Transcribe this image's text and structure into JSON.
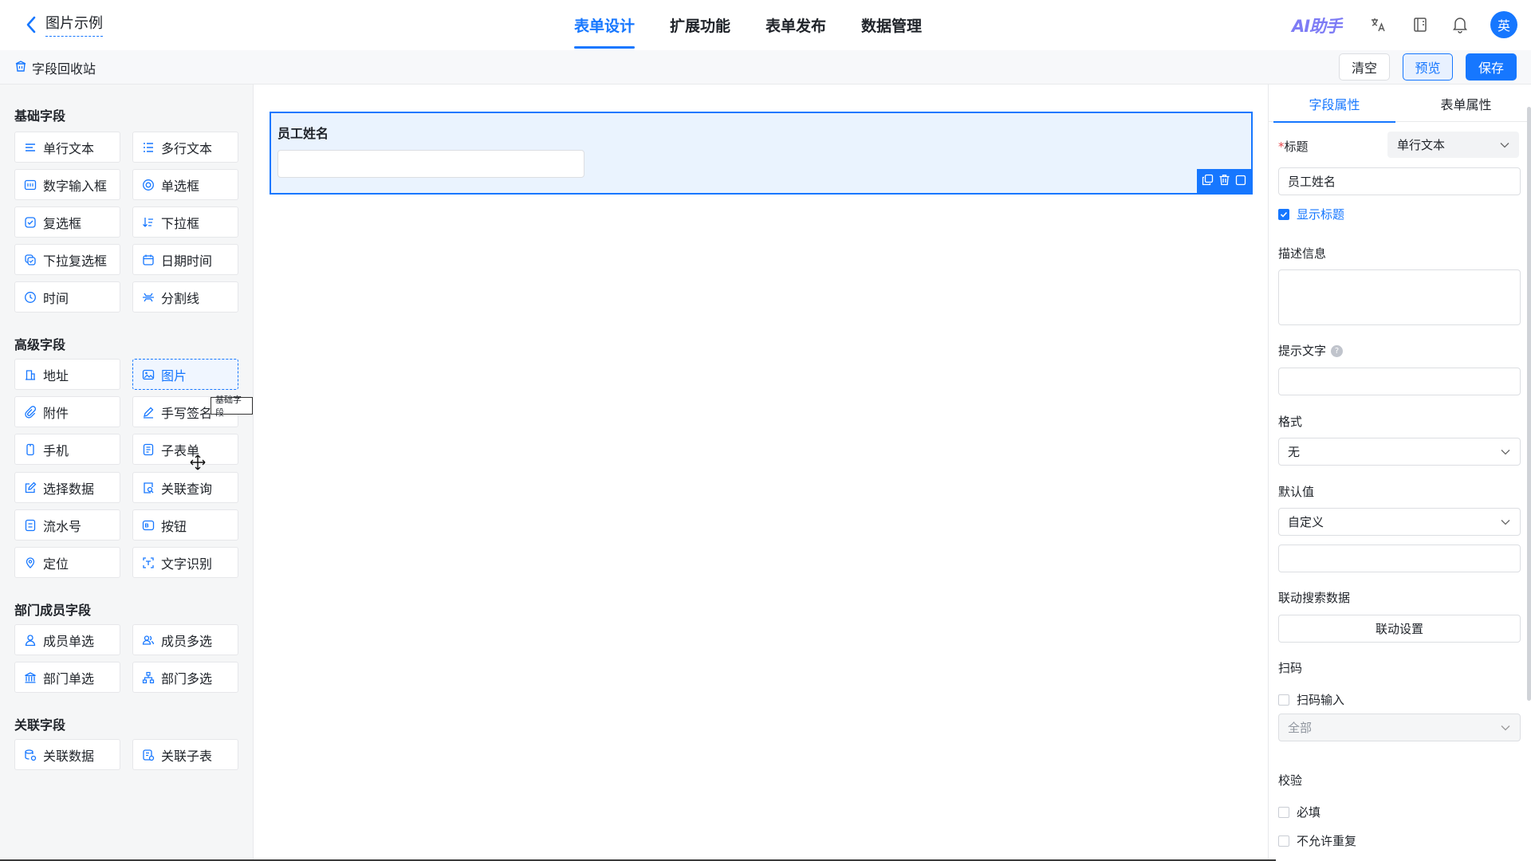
{
  "header": {
    "app_title": "图片示例",
    "nav_tabs": [
      "表单设计",
      "扩展功能",
      "表单发布",
      "数据管理"
    ],
    "ai_label": "AI助手",
    "avatar_text": "英"
  },
  "toolbar": {
    "recycle_label": "字段回收站",
    "clear_label": "清空",
    "preview_label": "预览",
    "save_label": "保存"
  },
  "palette": {
    "groups": [
      {
        "title": "基础字段",
        "items": [
          "单行文本",
          "多行文本",
          "数字输入框",
          "单选框",
          "复选框",
          "下拉框",
          "下拉复选框",
          "日期时间",
          "时间",
          "分割线"
        ]
      },
      {
        "title": "高级字段",
        "items": [
          "地址",
          "图片",
          "附件",
          "手写签名",
          "手机",
          "子表单",
          "选择数据",
          "关联查询",
          "流水号",
          "按钮",
          "定位",
          "文字识别"
        ]
      },
      {
        "title": "部门成员字段",
        "items": [
          "成员单选",
          "成员多选",
          "部门单选",
          "部门多选"
        ]
      },
      {
        "title": "关联字段",
        "items": [
          "关联数据",
          "关联子表"
        ]
      }
    ],
    "tooltip": "基础字段"
  },
  "canvas": {
    "field_label": "员工姓名"
  },
  "properties": {
    "tabs": [
      "字段属性",
      "表单属性"
    ],
    "title_label": "标题",
    "title_type": "单行文本",
    "title_value": "员工姓名",
    "show_title_label": "显示标题",
    "description_label": "描述信息",
    "hint_label": "提示文字",
    "format_label": "格式",
    "format_value": "无",
    "default_label": "默认值",
    "default_value": "自定义",
    "linkage_label": "联动搜索数据",
    "linkage_button": "联动设置",
    "scan_label": "扫码",
    "scan_input_label": "扫码输入",
    "scan_scope": "全部",
    "validation_label": "校验",
    "required_label": "必填",
    "no_duplicate_label": "不允许重复"
  },
  "colors": {
    "accent": "#1677ff",
    "ai": "#7e7cf5"
  }
}
